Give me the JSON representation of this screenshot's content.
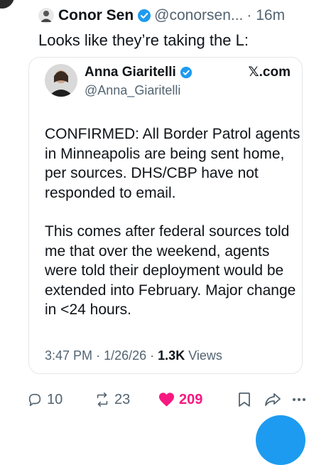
{
  "tweet": {
    "author_name": "Conor Sen",
    "handle": "@conorsen...",
    "time": "· 16m",
    "text": "Looks like they’re taking the L:"
  },
  "quote": {
    "author_name": "Anna Giaritelli",
    "handle": "@Anna_Giaritelli",
    "source": "𝕏.com",
    "paragraphs": [
      "CONFIRMED: All Border Patrol agents in Minneapolis are being sent home, per sources. DHS/CBP have not responded to email.",
      "This comes after federal sources told me that over the weekend, agents were told their deployment would be extended into February. Major change in <24 hours."
    ],
    "time": "3:47 PM",
    "date": "1/26/26",
    "sep": "·",
    "views_count": "1.3K",
    "views_label": "Views"
  },
  "actions": {
    "replies": "10",
    "reposts": "23",
    "likes": "209",
    "icons": [
      "reply-icon",
      "repost-icon",
      "heart-icon",
      "bookmark-icon",
      "share-icon",
      "more-icon"
    ]
  },
  "colors": {
    "text": "#0f1419",
    "secondary": "#536471",
    "verified": "#1d9bf0",
    "like": "#f91880",
    "border": "#e3e6e9"
  }
}
